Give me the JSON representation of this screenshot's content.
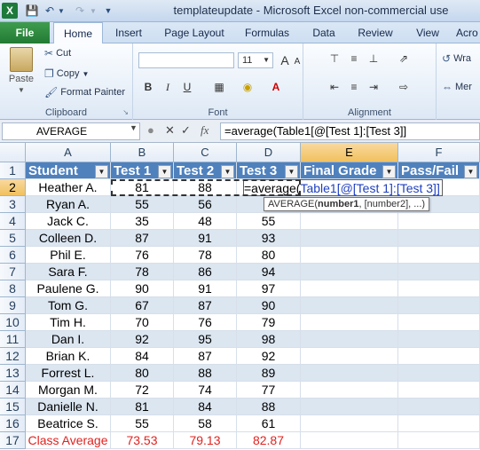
{
  "window": {
    "title": "templateupdate - Microsoft Excel non-commercial use",
    "logo_glyph": "X"
  },
  "ribbon_tabs": [
    "File",
    "Home",
    "Insert",
    "Page Layout",
    "Formulas",
    "Data",
    "Review",
    "View",
    "Acro"
  ],
  "clipboard": {
    "paste": "Paste",
    "cut": "Cut",
    "copy": "Copy",
    "format_painter": "Format Painter",
    "label": "Clipboard"
  },
  "font_group": {
    "size": "11",
    "bold": "B",
    "italic": "I",
    "underline": "U",
    "label": "Font"
  },
  "alignment_group": {
    "wrap": "Wra",
    "merge": "Mer",
    "label": "Alignment"
  },
  "formula_bar": {
    "name_box": "AVERAGE",
    "fx": "fx",
    "formula": "=average(Table1[@[Test 1]:[Test 3]]"
  },
  "grid": {
    "columns": [
      "A",
      "B",
      "C",
      "D",
      "E",
      "F"
    ],
    "rows": [
      "1",
      "2",
      "3",
      "4",
      "5",
      "6",
      "7",
      "8",
      "9",
      "10",
      "11",
      "12",
      "13",
      "14",
      "15",
      "16",
      "17"
    ],
    "headers": [
      "Student",
      "Test 1",
      "Test 2",
      "Test 3",
      "Final Grade",
      "Pass/Fail"
    ],
    "students": [
      {
        "name": "Heather A.",
        "t1": "81",
        "t2": "88",
        "t3": ""
      },
      {
        "name": "Ryan A.",
        "t1": "55",
        "t2": "56",
        "t3": ""
      },
      {
        "name": "Jack C.",
        "t1": "35",
        "t2": "48",
        "t3": "55"
      },
      {
        "name": "Colleen D.",
        "t1": "87",
        "t2": "91",
        "t3": "93"
      },
      {
        "name": "Phil E.",
        "t1": "76",
        "t2": "78",
        "t3": "80"
      },
      {
        "name": "Sara F.",
        "t1": "78",
        "t2": "86",
        "t3": "94"
      },
      {
        "name": "Paulene G.",
        "t1": "90",
        "t2": "91",
        "t3": "97"
      },
      {
        "name": "Tom G.",
        "t1": "67",
        "t2": "87",
        "t3": "90"
      },
      {
        "name": "Tim H.",
        "t1": "70",
        "t2": "76",
        "t3": "79"
      },
      {
        "name": "Dan I.",
        "t1": "92",
        "t2": "95",
        "t3": "98"
      },
      {
        "name": "Brian K.",
        "t1": "84",
        "t2": "87",
        "t3": "92"
      },
      {
        "name": "Forrest L.",
        "t1": "80",
        "t2": "88",
        "t3": "89"
      },
      {
        "name": "Morgan M.",
        "t1": "72",
        "t2": "74",
        "t3": "77"
      },
      {
        "name": "Danielle N.",
        "t1": "81",
        "t2": "84",
        "t3": "88"
      },
      {
        "name": "Beatrice S.",
        "t1": "55",
        "t2": "58",
        "t3": "61"
      }
    ],
    "average_row": {
      "label": "Class Average",
      "t1": "73.53",
      "t2": "79.13",
      "t3": "82.87"
    },
    "editing_formula_prefix": "=average(",
    "editing_formula_ref": "Table1[@[Test 1]:[Test 3]]",
    "tooltip": {
      "fn": "AVERAGE(",
      "bold": "number1",
      "rest": ", [number2], ...)"
    }
  },
  "colors": {
    "header_blue": "#4f81bd",
    "band": "#dce6f1",
    "red": "#e0221f",
    "ref_blue": "#1f3fbf"
  }
}
